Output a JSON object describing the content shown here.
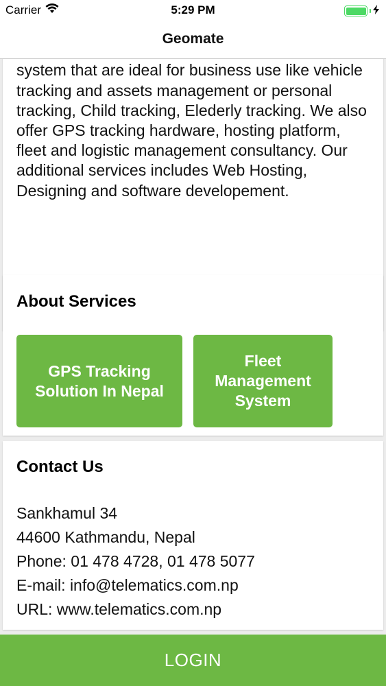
{
  "status_bar": {
    "carrier": "Carrier",
    "time": "5:29 PM"
  },
  "nav": {
    "title": "Geomate"
  },
  "intro": {
    "text": "solution for enterprise or personal use across Nepal. We offer a variety of remote tracking system that are ideal for business use like vehicle tracking and assets management or personal tracking, Child tracking, Elederly tracking. We also offer GPS tracking hardware, hosting platform, fleet and logistic management consultancy. Our additional services includes Web Hosting, Designing and software developement."
  },
  "services": {
    "title": "About Services",
    "buttons": [
      {
        "label": "GPS Tracking Solution In Nepal"
      },
      {
        "label": "Fleet Management System"
      }
    ]
  },
  "contact": {
    "title": "Contact Us",
    "lines": [
      "Sankhamul 34",
      "44600 Kathmandu, Nepal",
      "Phone: 01 478 4728, 01 478 5077",
      "E-mail: info@telematics.com.np",
      "URL: www.telematics.com.np"
    ]
  },
  "login": {
    "label": "LOGIN"
  },
  "colors": {
    "accent": "#6db844",
    "battery": "#4cd964"
  },
  "icons": [
    "wifi-icon",
    "charging-bolt-icon"
  ]
}
